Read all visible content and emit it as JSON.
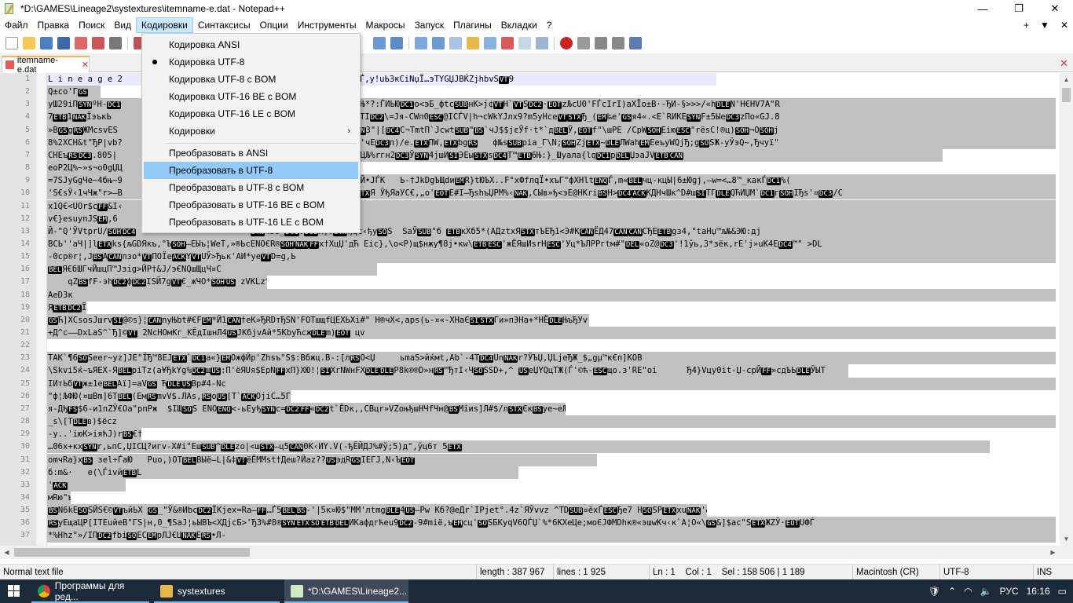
{
  "window": {
    "title": "*D:\\GAMES\\Lineage2\\systextures\\itemname-e.dat - Notepad++",
    "controls": {
      "minimize": "—",
      "maximize": "❐",
      "close": "✕"
    }
  },
  "menu": {
    "items": [
      "Файл",
      "Правка",
      "Поиск",
      "Вид",
      "Кодировки",
      "Синтаксисы",
      "Опции",
      "Инструменты",
      "Макросы",
      "Запуск",
      "Плагины",
      "Вкладки",
      "?"
    ],
    "active_index": 4,
    "right": {
      "plus": "+",
      "down": "▼",
      "close": "✕"
    }
  },
  "encoding_menu": {
    "items": [
      {
        "label": "Кодировка ANSI",
        "checked": false,
        "submenu": false
      },
      {
        "label": "Кодировка UTF-8",
        "checked": true,
        "submenu": false
      },
      {
        "label": "Кодировка UTF-8 с BOM",
        "checked": false,
        "submenu": false
      },
      {
        "label": "Кодировка UTF-16 BE с BOM",
        "checked": false,
        "submenu": false
      },
      {
        "label": "Кодировка UTF-16 LE с BOM",
        "checked": false,
        "submenu": false
      },
      {
        "label": "Кодировки",
        "checked": false,
        "submenu": true
      },
      {
        "label": "Преобразовать в ANSI",
        "checked": false,
        "submenu": false
      },
      {
        "label": "Преобразовать в UTF-8",
        "checked": false,
        "submenu": false,
        "selected": true
      },
      {
        "label": "Преобразовать в UTF-8 с BOM",
        "checked": false,
        "submenu": false
      },
      {
        "label": "Преобразовать в UTF-16 BE с BOM",
        "checked": false,
        "submenu": false
      },
      {
        "label": "Преобразовать в UTF-16 LE с BOM",
        "checked": false,
        "submenu": false
      }
    ],
    "submenu_arrow": "›"
  },
  "tab": {
    "label": "itemname-e.dat",
    "close": "✕"
  },
  "tabbar_close": "✕",
  "editor": {
    "line_numbers": [
      "1",
      "2",
      "3",
      "4",
      "5",
      "6",
      "7",
      "8",
      "9",
      "10",
      "11",
      "12",
      "13",
      "14",
      "15",
      "16",
      "17",
      "18",
      "19",
      "20",
      "21",
      "22",
      "23",
      "24",
      "25",
      "26",
      "27",
      "28",
      "29",
      "30",
      "31",
      "32",
      "33",
      "34",
      "35",
      "36",
      "37"
    ],
    "lines": [
      "L i n e a g e 2                          MЦђs¥STXўћACKЦБЈ…КеЛш,Ѓ,у!uЬ3кСiNџЇ…эТYGЏJВЌZjhbvSVT9",
      "Q±co'ГGS",
      "уШ29iПSYNºH-DC1                          NxUS±Ј&Ўzј*ъSIkЈBS63QaЊ*?:ЃИЬЮDC1о<эБ_фtсSUBнК>ј¢VTH`VTSDC2·EOTzЉсU0'FЃсIrI)aXЇо±В·-ЂИ-§>>>/«hDLEN'Н€НV7A\"R",
      "7ETB1NAKЇэъкЬ                            К[у™щЏЖ,uFSI=ШПЕТВ'tКSTIDC2\\=Јя-СWп0ESC@IСЃV|h¬сWkYЈлх9?m5уНсеVTSTXЂ_(EM‰е'GSя4«.<Е`RИКЕSYNF±5ЫеDC3zПо«GЈ.8",
      "»BGSgRSЖМсsvES                           ЙЇл/ЙfЕд~ўЇ}.СШхгфGSSYN3\"|[DC4С¬ТmtП`ЈсwtSUB\"BS`чЈ$$jєЎf·t*`дBELЎ,EOTf\"\\шРЕ /СрWSOHЕiюESC\"rёsС!®ц)SOH¬OSOHj",
      "8%2ХСН&t\"ЂР|vb?                          ИНеACKKА]-эЕЮсQ>ВСYп»О'чЕDC3п)/е.ETXПW,ETXbgRS   ф№sSUBрia_Г\\N;SOHZјETX~DLEЛWahEMЕеъуWQјЂ;gSOSЖ-уЎэQ~,Ђчуї\"",
      "СНЕъRSDC3.805|                           £Ї«Пr,ёNРЇЙmъ'бЎ€ѓсќаГЦЉ%rгн2DC3ЎSYN4јшИSIЭЕыSTXsDC4Т™ETB6Њ:}_Шуала{lqDC1рDELЏэаJVETBCAN",
      "eoP2Ц%~»s¬о0gЏЦ",
      "=7SЈyGgЧе~4бњ~9                          k-zEOT,\"T¦ºАГђ%Сб'ЃтN:Й•ЈЃК   Ь-†ЈkDgЪЩdиEMR}tЮЪХ..F°хФfлqЇ•хъГ\"фХНltENQЃ,m«BELчц-кцЫ|6±Юgj,—w=<…8™_какЃDC1%(",
      "'Ѕ€sЎ‹1чЧж\"r>–В                           Њ€НЖЩ,>№ЎЗЎЎ}ЂN%Х7Е±ETXЯ ЎђЯаУС€,„о'EOTЕ#І—ЂshъЏРМ%‹NAK,СЫв»ђ<эЕ@НКriBSH>DC4ACKКДНчШк^D#шSITГDLEQЋИЏМ`DC1гSOHІЂs'¤DC3/С",
      "x1Q€<UОr$cFF&I‹                          ",
      "v€}esuynЈSEM,6                           ",
      "Й-\"Q'ЎVtprU/SOHDC4                       SYNчSо_DC1VDC1M]TSYNђqс‹ђуSOS  SаЎSUB\"б ETBкХб5*(АДztхЯSTXтЪЕЂ1<Э#КCANЁД47CANCANСЂЕETBgз4,°taНџ™љ№&ЭЮ:дј",
      "ВСЬ''аЧ|]lETXkѕ{љGDЯкъ,\"ЪSOH—ЕЫъ¦WеТ,»®ЬсENO€R®SOHNAKFFх†ХцЏ'дЋ Еіс},\\о<P)щ$нжу¶8ј•кw\\ETBESC'жЁЯшИsrНESC'Уц*ЪЛРРгtм#\"DEL«оZ@DC3'!1ўь,3*зёк,rЕ'ј»uК4ЕDC4™\" >DL",
      "-0ср®r¦,ЈBSACANпзо*VTПОЇеACKYVTUЎ>Ђьк'АИ*уеVTD=g,Ь",
      "BELЯ€бШГчЙшцП™Јзіg>ЙР†&Ј/э€NQшЩцЧ¤С",
      "    qZBSfF-эhDC2фDC2IЅЙ7gVT€_жЧО*SOHUS zVKLz^VTНоПАЃsXQ   ПNAKdDC3нЄЮРтп°r®7FЅД ·&Wаt'D»STXCANУђ\\цЛ¶-BELЊ¶Чѕ§уENOЂYа‹FSуETBЁЅ«DEL†sН@Нhr@ЕIi3DC2.НіЧф?Ц>Х>",
      "AeD3к",
      "ЯETBDC2ЇЮЊьЅTqзDELD JGSX_uKa/NAK'јќцЂДN7FFLшTs¦‡·ЁQ`ЉяЕ<эОЇчмыЎЂјч¦sЯ-ЈЛFF±я\\·к+",
      "GSЋ]ХСsоsЈшrvSI@©s}¦CANnуЊbt#€FEM*Й1CAN†еК»ЂRDтЂЅN'FOTшщfЦЕХЬХі#\" Н®чХ<,аps(ь-¤«-ХНаЄSISTXГи»пЭНа+*НЁDLEЊъЂУv-Пп4•RS=INAKуАфщ·CANVј—;<6SOBELУКEOTЂфНEOTIiE",
      "+Д^с——DxLaЅ^`Ђ]©VT 2NсНОмКг_КЁдІшнЛ4USЈКбјvАй*5КbуЋсжDLEm)EOT цv",
      "",
      "ТАК`¶6SOSeer~уz]JЕ\"ЇЂ™8ЕJETX`DC1а«}EMОжфЙр'Zhsъ°S$:Вбжц.В-:[лRSО<Џ     ьmаЅ>йќмt,Аb`-4ТDC4UnNAKr?ЎЪЏ,ЏLјеЂЖ_$„gµ™к€п]КОВ",
      "\\Ѕkvi5ќ~ъЯЕХ-ЯBELpiTz(а¥ЂkYg%DC2щUS:П'ёЯUя$ЕpNFFхП}ХЮ!¦SIХrNWнFХDLEDLEP8k®®D»нRS™ЂтІ‹ЧSOSSD+,^ USеЏYQцТЖ(Ѓ'©ћ-ESCщо.з'RЕ\"оі      Ђ4}Vцу0іt-Џ-срЙFF»сдЪЬDLEЎЫТ",
      "ІИтЬбVTж±1еBELАї]=аVGS ЋDLEUSBр#4-Nс",
      "\"ф¦ЉФЮ(¤шВm]6ТBEL(ЕмRSmvV$.ЛАs,RSоUS[Т`ACKОјіС…5Гзёе;Ч‡'пЈ7НDdпј?ЊаД&ц(ђ?hDC2ЉсФПЎbS=4-WЈfА!тSЧР)мЭ<І®Э‡±Мц‡тТ",
      "я-ДђFS$6-и1пZЎ€Оа\"рпРж  $ІЩSOS ENOENQ<-ьЕуђSYNс=DC2FF«DC2t`ЁDк,,СВцr»VZоњђшНЧfЧн@BSМіиs]Л#$/лSTXЄкBSуе~еЉзDC4‡=KSIоSYN«VTНР\\#ОЅшSI#?Піg•@DC1р7тъ©QНDLEЎЗВќ",
      "_s\\[TDLEв)$ёсz",
      "-у..'іюК>іяћЈ)rBS€†STXьEM&?VTДКНчё:nЕ.ІfFFЎЖПЇлсCANSw,4Ўег©™сBSХч<хрХЬ#€DC1Іe{јkСјEOToКQР‡=@ДыЕГ]Ё8ЪSIХBWSOSOљm$ЋХDC2ѕЕХХ¢<МР'ЇЬЯЙ^ОnНiЅ¶Жr-gу{Ѕ-'",
      "…06х+кхSYNr,ьпС,ЏІСЦ?игv-Х#і\"ЕшSUB^DLEzо|<шSTX—ц5CAN0К‹ИY.V(-ђЁЙДЈ%#ў;5)д°,ўц6т 5ETX",
      "omчRа}хBS зеl+ЃаЮ   Рuо,)ОТBELВЫё—L|&‡VTёЁММst†Деш?Йаz??USэдRGSІЕГЈ,N‹ЪEOT",
      "б:m&·   е(\\ЃіvйETBL",
      "'ACK",
      "мRю\"ъЂЃ^R„pSUBETBDEL†Т—Лу¢VdРЦђРяЗt¦rIU®Q>`,-5—¶,DLEћ¦юЏ[DC3U®YrвIZI\"оENQPSIDLE60krПХ'П?-П0аћјшС",
      "BSN6kЕSOSЙЅ€©VTъйЬХ GS_\"Ў&®ИbсDC2ЇКјех=Ra—FF…Ѓ5BELBS-'|5к¤Ю$\"ММ'лtmgDLE4US—Рw Кб?@еДr`ІРјеt°.4z`ЯЎvvz ^ТDSUB¤ёхЃESCЂе7 НSOSPETXхuNAK'&ХЪВ™уФж,5ssUSЬі)#ШНЭ",
      "RSуЕщаЦР[ІТЕuйеВ\"ГЅ|н,0_¶ЅаЈ¦ьЫВЪ<ХДјсБ>'Ђ3%#8®SYNETXSOETBDELИКафдгћеu9DC2-9#mіё,ъEMсц'SOSБКуqV6QЃЏ`%*6КХеЦе;моЄЈФМDhк®«эшwКч‹к`А¦О«\\GS&]$ас\"ЅETXЖZЎ·EOTUФЃ",
      "*%Нhz°»/ІПDC2fbіSOECEMрЛЈ€ЦNAKERS•Л-"
    ]
  },
  "scrollbars": {
    "up": "▲",
    "down": "▼",
    "left": "◀",
    "right": "▶"
  },
  "status": {
    "type": "Normal text file",
    "length": "length : 387 967",
    "lines": "lines : 1 925",
    "pos": "Ln : 1    Col : 1    Sel : 158 506 | 1 189",
    "eol": "Macintosh (CR)",
    "encoding": "UTF-8",
    "mode": "INS"
  },
  "taskbar": {
    "tasks": [
      {
        "label": "Программы для ред..."
      },
      {
        "label": "systextures"
      },
      {
        "label": "*D:\\GAMES\\Lineage2..."
      }
    ],
    "lang": "РУС",
    "time": "16:16"
  }
}
